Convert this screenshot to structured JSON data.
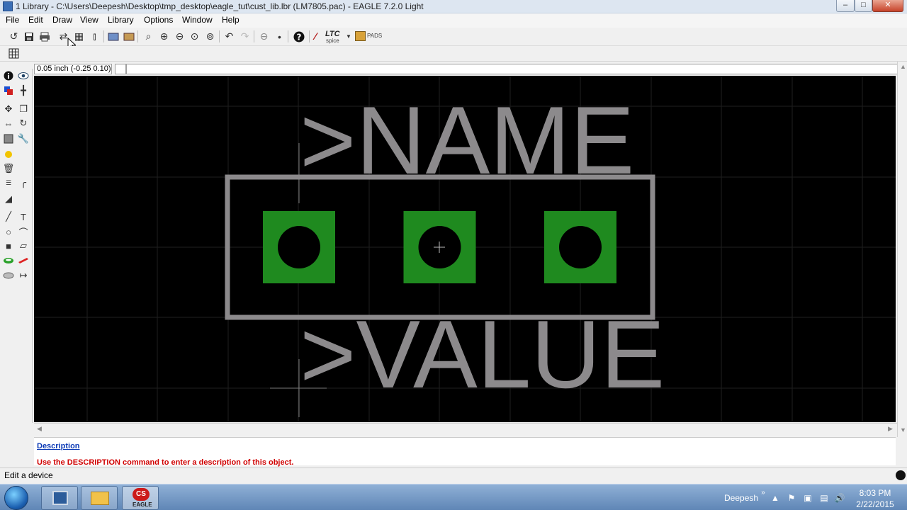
{
  "window": {
    "title": "1 Library - C:\\Users\\Deepesh\\Desktop\\tmp_desktop\\eagle_tut\\cust_lib.lbr (LM7805.pac) - EAGLE 7.2.0 Light",
    "minimize_glyph": "–",
    "maximize_glyph": "□",
    "close_glyph": "✕"
  },
  "menubar": {
    "items": [
      "File",
      "Edit",
      "Draw",
      "View",
      "Library",
      "Options",
      "Window",
      "Help"
    ]
  },
  "toolbar": {
    "ltc_label": "LTC",
    "ltc_sub": "spice",
    "pads_label": "PADS"
  },
  "command_line": {
    "coordinate": "0.05 inch (-0.25 0.10)",
    "value": ""
  },
  "canvas": {
    "name_text": ">NAME",
    "value_text": ">VALUE",
    "pad_count": 3,
    "pad_color": "#1f8a1f",
    "outline_color": "#8c8a8c",
    "text_color": "#8c8a8c",
    "background": "#000000"
  },
  "description": {
    "title": "Description",
    "text": "Use the DESCRIPTION command to enter a description of this object."
  },
  "status": {
    "text": "Edit a device"
  },
  "taskbar": {
    "user": "Deepesh",
    "time": "8:03 PM",
    "date": "2/22/2015",
    "eagle_label": "EAGLE",
    "eagle_logo": "CS"
  }
}
